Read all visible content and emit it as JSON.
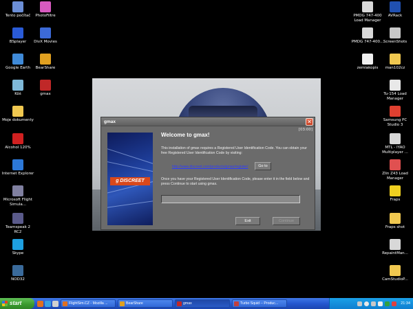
{
  "desktop": {
    "left_icons": [
      {
        "label": "Tento počítač",
        "icon": "computer-icon",
        "color": "#6b8ed6"
      },
      {
        "label": "PhotoFiltre",
        "icon": "photofiltre-icon",
        "color": "#d85ac0"
      },
      {
        "label": "BSplayer",
        "icon": "bsplayer-icon",
        "color": "#2a5bd7"
      },
      {
        "label": "DivX Movies",
        "icon": "divx-icon",
        "color": "#3c6ad8"
      },
      {
        "label": "Google Earth",
        "icon": "globe-icon",
        "color": "#3f8ad8"
      },
      {
        "label": "BearShare",
        "icon": "bearshare-icon",
        "color": "#e0a020"
      },
      {
        "label": "Kôš",
        "icon": "recycle-bin-icon",
        "color": "#7fb8d8"
      },
      {
        "label": "gmax",
        "icon": "gmax-icon",
        "color": "#c02828"
      },
      {
        "label": "Moje dokumenty",
        "icon": "folder-icon",
        "color": "#f0c850"
      },
      {
        "label": "Alcohol 120%",
        "icon": "alcohol-icon",
        "color": "#d02020"
      },
      {
        "label": "Internet Explorer",
        "icon": "internet-explorer-icon",
        "color": "#2c78d8"
      },
      {
        "label": "Microsoft Flight Simula...",
        "icon": "flight-sim-icon",
        "color": "#8080a0"
      },
      {
        "label": "Teamspeak 2 RC2",
        "icon": "teamspeak-icon",
        "color": "#5a5a8a"
      },
      {
        "label": "Skype",
        "icon": "skype-icon",
        "color": "#1e9fe0"
      },
      {
        "label": "NOD32",
        "icon": "nod32-icon",
        "color": "#3a6a9a"
      }
    ],
    "right_icons": [
      {
        "label": "PMDG 747-400 Load Manager",
        "icon": "pmdg-icon",
        "color": "#d8d8d8"
      },
      {
        "label": "AVRack",
        "icon": "avrack-icon",
        "color": "#2050b0"
      },
      {
        "label": "PMDG 747-400...",
        "icon": "pmdg-icon",
        "color": "#d8d8d8"
      },
      {
        "label": "ScreenShots",
        "icon": "camera-icon",
        "color": "#c8c8c8"
      },
      {
        "label": "zemiakopis",
        "icon": "text-file-icon",
        "color": "#f0f0f0"
      },
      {
        "label": "man102cz",
        "icon": "folder-icon",
        "color": "#f0c850"
      },
      {
        "label": "Tu-154 Load Manager",
        "icon": "tu154-icon",
        "color": "#e8e8e8"
      },
      {
        "label": "Samsung PC Studio 3",
        "icon": "samsung-icon",
        "color": "#e04030"
      },
      {
        "label": "MTL - IYAO Multiplayer ...",
        "icon": "mtl-icon",
        "color": "#d8d8d8"
      },
      {
        "label": "Zlin Z43 Load Manager",
        "icon": "zlin-icon",
        "color": "#e05050"
      },
      {
        "label": "Fraps",
        "icon": "fraps-icon",
        "color": "#f0d020"
      },
      {
        "label": "Fraps shot",
        "icon": "folder-icon",
        "color": "#f0c850"
      },
      {
        "label": "RepaintMan...",
        "icon": "repaint-icon",
        "color": "#d8d8d8"
      },
      {
        "label": "CamStudioP...",
        "icon": "folder-icon",
        "color": "#f0c850"
      }
    ]
  },
  "dialog": {
    "title": "gmax",
    "close_glyph": "✕",
    "welcome": "Welcome to gmax!",
    "timer": "[03:00]",
    "intro": "This installation of gmax requires a Registered User Identification Code. You can obtain your free Registered User Identification Code by visiting:",
    "link": "http://www.discreet.com/products/gmax/register/",
    "goto_label": "Go to",
    "instructions": "Once you have your Registered User Identification Code, please enter it in the field below and press Continue to start using gmax.",
    "code_value": "",
    "exit_label": "Exit",
    "continue_label": "Continue",
    "banner_logo": "g DISCREET"
  },
  "taskbar": {
    "start_label": "start",
    "tasks": [
      {
        "label": "FlightSim.CZ - Mozilla ...",
        "icon_color": "#e07020",
        "active": false
      },
      {
        "label": "BearShare",
        "icon_color": "#e0a020",
        "active": false
      },
      {
        "label": "gmax",
        "icon_color": "#c02828",
        "active": true
      },
      {
        "label": "Turbo Squid -- Produc...",
        "icon_color": "#c04040",
        "active": false
      }
    ],
    "clock": "21:34"
  }
}
